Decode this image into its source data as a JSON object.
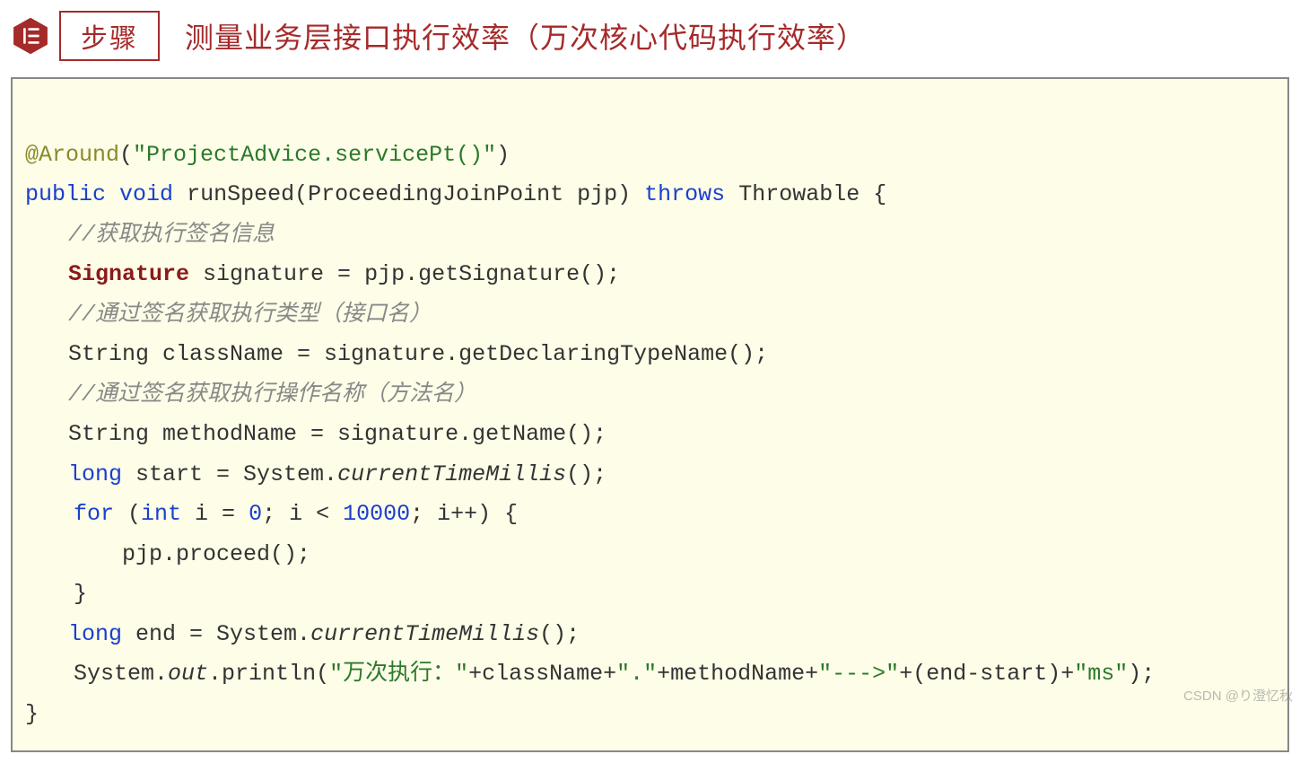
{
  "header": {
    "badge": "步骤",
    "title": "测量业务层接口执行效率（万次核心代码执行效率）"
  },
  "code": {
    "l1_ann": "@Around",
    "l1_paren_open": "(",
    "l1_str": "\"ProjectAdvice.servicePt()\"",
    "l1_paren_close": ")",
    "l2_kw1": "public",
    "l2_kw2": "void",
    "l2_method": "runSpeed",
    "l2_params": "(ProceedingJoinPoint pjp) ",
    "l2_kw3": "throws",
    "l2_rest": " Throwable {",
    "l3_comment": "//获取执行签名信息",
    "l4_type": "Signature",
    "l4_rest": " signature = pjp.getSignature();",
    "l5_comment": "//通过签名获取执行类型（接口名）",
    "l6": "String className = signature.getDeclaringTypeName();",
    "l7_comment": "//通过签名获取执行操作名称（方法名）",
    "l8": "String methodName = signature.getName();",
    "l9_kw": "long",
    "l9_a": " start = System.",
    "l9_it": "currentTimeMillis",
    "l9_b": "();",
    "l10_kw1": "for",
    "l10_a": " (",
    "l10_kw2": "int",
    "l10_b": " i = ",
    "l10_n1": "0",
    "l10_c": "; i < ",
    "l10_n2": "10000",
    "l10_d": "; i++) {",
    "l11": "pjp.proceed();",
    "l12": "}",
    "l13_kw": "long",
    "l13_a": " end = System.",
    "l13_it": "currentTimeMillis",
    "l13_b": "();",
    "l14_a": "System.",
    "l14_out": "out",
    "l14_b": ".println(",
    "l14_s1": "\"万次执行：\"",
    "l14_c": "+className+",
    "l14_s2": "\".\"",
    "l14_d": "+methodName+",
    "l14_s3": "\"--->\"",
    "l14_e": "+(end-start)+",
    "l14_s4": "\"ms\"",
    "l14_f": ");",
    "l15": "}"
  },
  "watermark": "CSDN @り澄忆秋"
}
